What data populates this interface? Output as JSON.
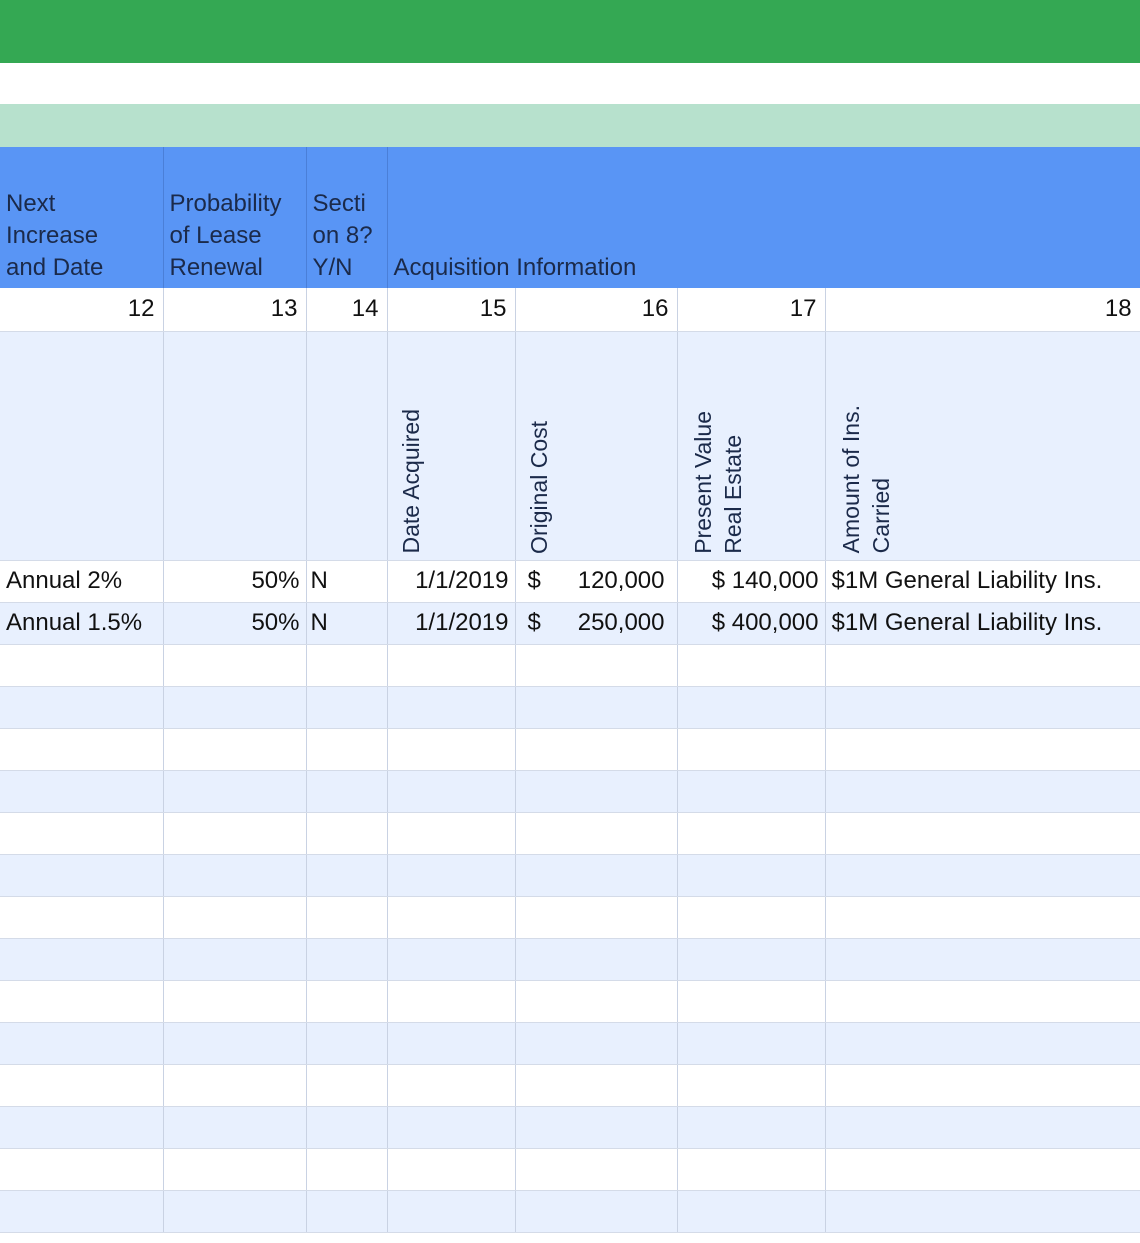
{
  "header": {
    "c12": [
      "Next",
      "Increase",
      "and Date"
    ],
    "c13": [
      "Probability",
      "of Lease",
      "Renewal"
    ],
    "c14": [
      "Secti",
      "on 8?",
      "Y/N"
    ],
    "acq": "Acquisition Information"
  },
  "col_numbers": [
    "12",
    "13",
    "14",
    "15",
    "16",
    "17",
    "18"
  ],
  "sub_headers": {
    "c15": "Date Acquired",
    "c16": "Original Cost",
    "c17": "Present Value\nReal Estate",
    "c18": "Amount of Ins.\nCarried"
  },
  "rows": [
    {
      "increase": "Annual 2%",
      "probability": "50%",
      "section8": "N",
      "date_acquired": "1/1/2019",
      "cost_sym": "$",
      "cost_val": "120,000",
      "present_value": "$ 140,000",
      "insurance": "$1M General Liability Ins."
    },
    {
      "increase": "Annual 1.5%",
      "probability": "50%",
      "section8": "N",
      "date_acquired": "1/1/2019",
      "cost_sym": "$",
      "cost_val": "250,000",
      "present_value": "$ 400,000",
      "insurance": "$1M General Liability Ins."
    }
  ],
  "colors": {
    "title_bar": "#34a853",
    "section_band": "#b7e1cd",
    "header_blue": "#5995f5",
    "row_alt": "#e8f0fe"
  }
}
